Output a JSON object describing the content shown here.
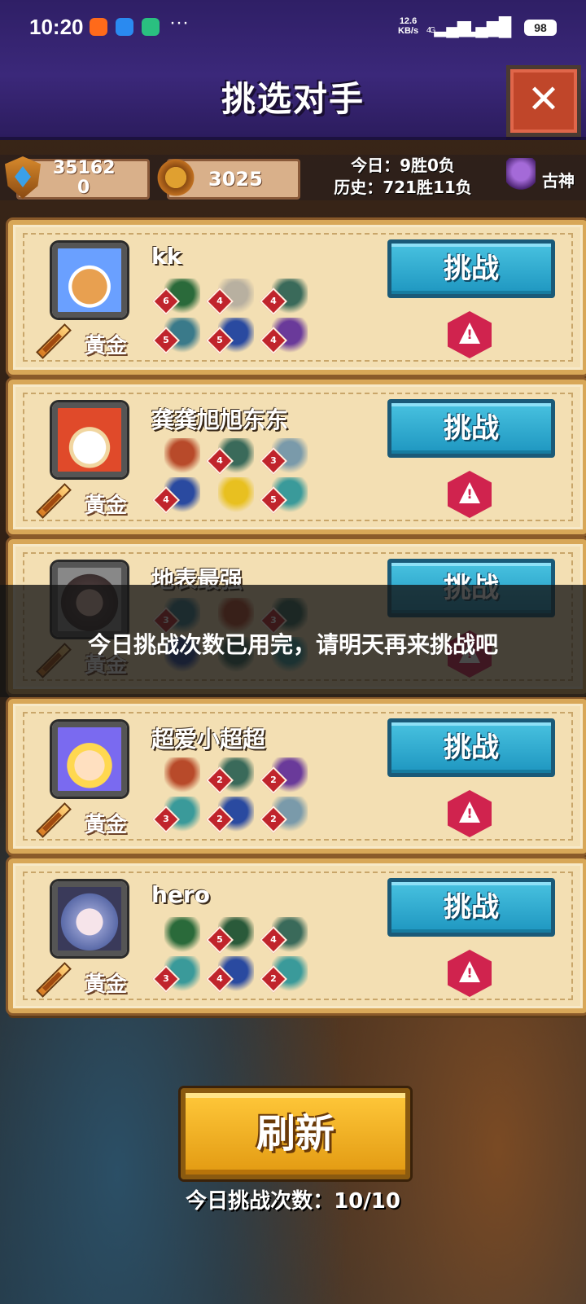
{
  "status_bar": {
    "time": "10:20",
    "net_speed": "12.6",
    "net_unit": "KB/s",
    "sim1": "4G",
    "sim2": "4G",
    "battery": "98"
  },
  "header": {
    "title": "挑选对手",
    "close_label": "✕"
  },
  "stats": {
    "score_top": "35162",
    "score_bottom": "0",
    "medal_value": "3025",
    "today_record": "今日：9胜0负",
    "history_record": "历史：721胜11负",
    "god_label": "古神"
  },
  "opponents": [
    {
      "name": "kk",
      "rank": "黃金",
      "challenge_label": "挑战",
      "heroes": [
        {
          "level": "6",
          "color": "#2a6a3a"
        },
        {
          "level": "4",
          "color": "#b8b0a0"
        },
        {
          "level": "4",
          "color": "#3a6a5a"
        },
        {
          "level": "5",
          "color": "#3a7a8a"
        },
        {
          "level": "5",
          "color": "#2a4aa0"
        },
        {
          "level": "4",
          "color": "#6a3a9a"
        }
      ]
    },
    {
      "name": "龚龚旭旭东东",
      "rank": "黃金",
      "challenge_label": "挑战",
      "heroes": [
        {
          "level": "",
          "color": "#b84a2a"
        },
        {
          "level": "4",
          "color": "#3a6a5a"
        },
        {
          "level": "3",
          "color": "#7a9aaa"
        },
        {
          "level": "4",
          "color": "#2a4aa0"
        },
        {
          "level": "",
          "color": "#e8c020"
        },
        {
          "level": "5",
          "color": "#3a9a9a"
        }
      ]
    },
    {
      "name": "地表最强",
      "rank": "黃金",
      "challenge_label": "挑战",
      "heroes": [
        {
          "level": "3",
          "color": "#3a7a8a"
        },
        {
          "level": "",
          "color": "#b84a2a"
        },
        {
          "level": "3",
          "color": "#3a6a5a"
        },
        {
          "level": "",
          "color": "#2a4aa0"
        },
        {
          "level": "",
          "color": "#3a6a5a"
        },
        {
          "level": "",
          "color": "#3a9a9a"
        }
      ]
    },
    {
      "name": "超爱小超超",
      "rank": "黃金",
      "challenge_label": "挑战",
      "heroes": [
        {
          "level": "",
          "color": "#b84a2a"
        },
        {
          "level": "2",
          "color": "#3a6a5a"
        },
        {
          "level": "2",
          "color": "#6a3a9a"
        },
        {
          "level": "3",
          "color": "#3a9a9a"
        },
        {
          "level": "2",
          "color": "#2a4aa0"
        },
        {
          "level": "2",
          "color": "#7a9aaa"
        }
      ]
    },
    {
      "name": "hero",
      "rank": "黃金",
      "challenge_label": "挑战",
      "heroes": [
        {
          "level": "",
          "color": "#2a6a3a"
        },
        {
          "level": "5",
          "color": "#2a5a3a"
        },
        {
          "level": "4",
          "color": "#3a6a5a"
        },
        {
          "level": "3",
          "color": "#3a9a9a"
        },
        {
          "level": "4",
          "color": "#2a4aa0"
        },
        {
          "level": "2",
          "color": "#3a9a9a"
        }
      ]
    }
  ],
  "toast": {
    "message": "今日挑战次数已用完，请明天再来挑战吧"
  },
  "footer": {
    "refresh_label": "刷新",
    "count_label": "今日挑战次数：10/10"
  },
  "colors": {
    "header_bg": "#3b287a",
    "card_bg": "#f3dfb3",
    "challenge_btn": "#1e96c0",
    "refresh_btn": "#e29a12",
    "report_btn": "#d0234e"
  }
}
